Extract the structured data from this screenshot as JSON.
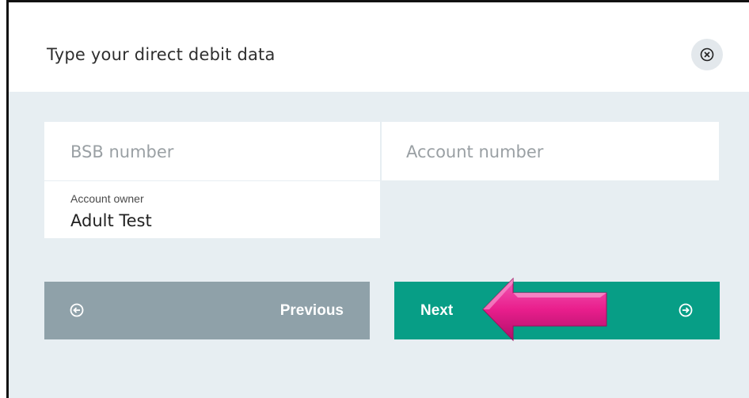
{
  "dialog": {
    "title": "Type your direct debit data"
  },
  "form": {
    "bsb": {
      "placeholder": "BSB number"
    },
    "account_number": {
      "placeholder": "Account number"
    },
    "account_owner": {
      "label": "Account owner",
      "value": "Adult Test"
    }
  },
  "buttons": {
    "previous": {
      "label": "Previous",
      "icon": "arrow-left-circle-icon"
    },
    "next": {
      "label": "Next",
      "icon": "arrow-right-circle-icon"
    },
    "close": {
      "icon": "close-circle-icon"
    }
  },
  "annotation": {
    "icon": "pointer-arrow-icon",
    "color": "#e91e8c"
  },
  "colors": {
    "previous_bg": "#8fa1a9",
    "next_bg": "#079e86",
    "panel_bg": "#e7eef2"
  }
}
